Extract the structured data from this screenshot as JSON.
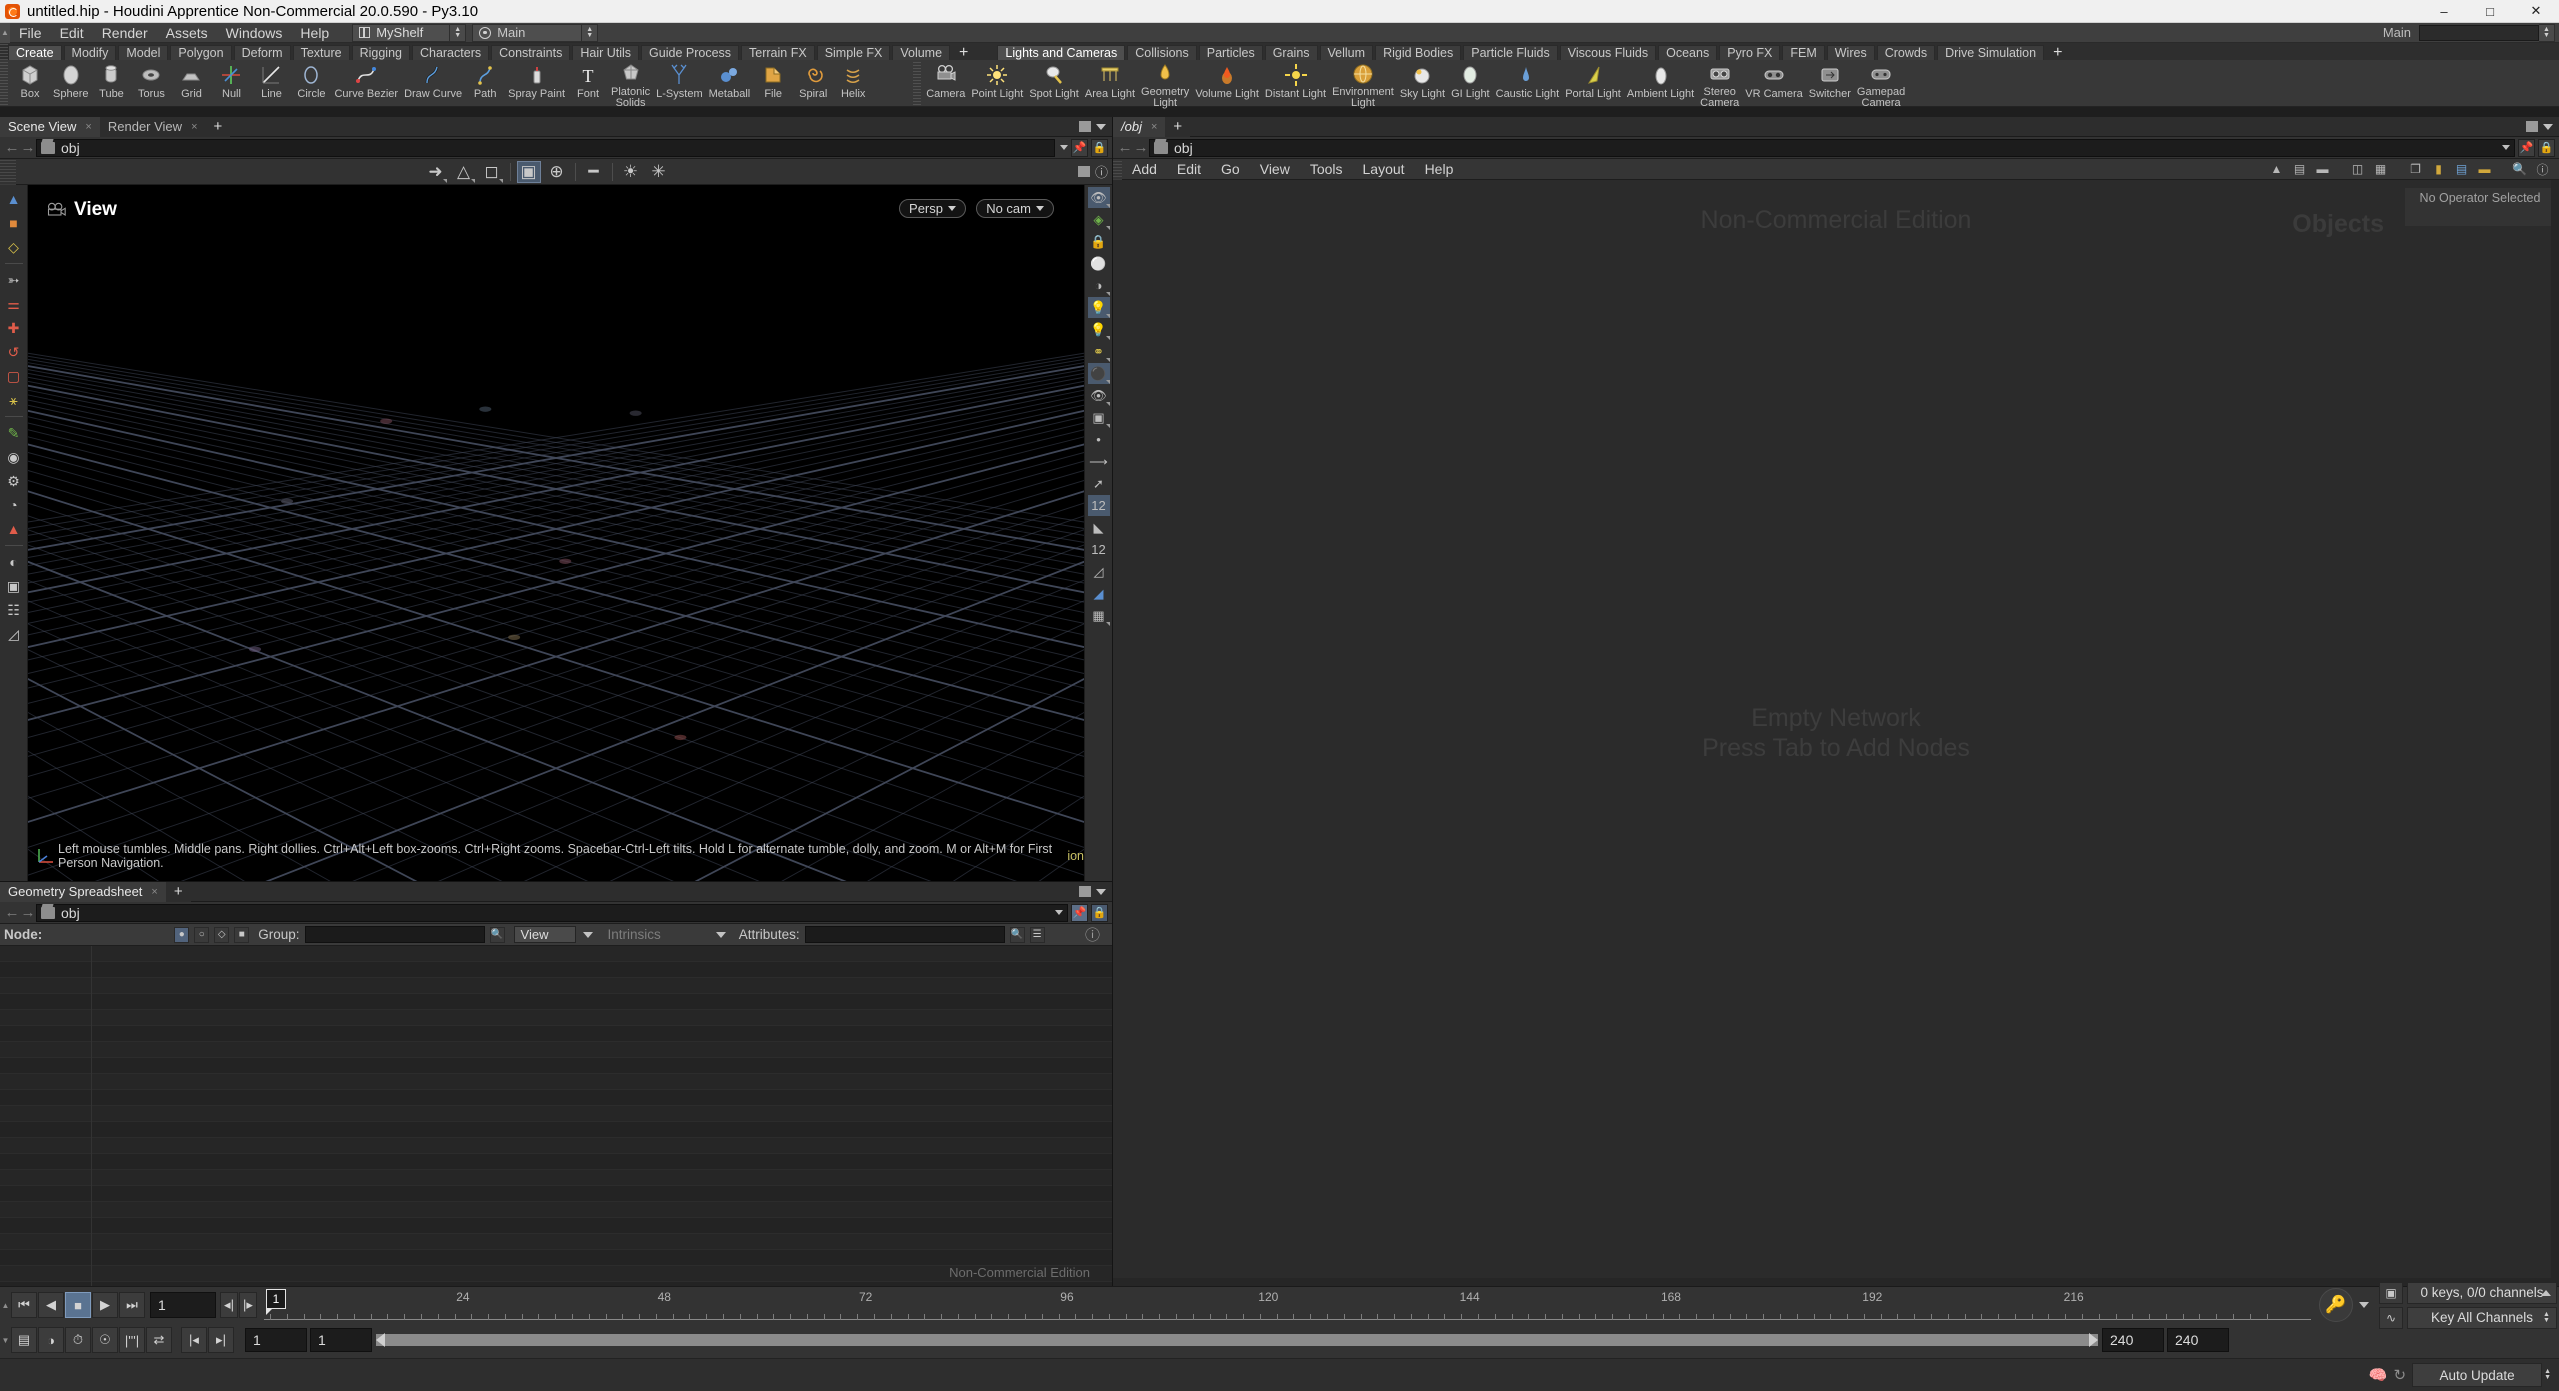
{
  "window": {
    "title": "untitled.hip - Houdini Apprentice Non-Commercial 20.0.590 - Py3.10",
    "minimize": "–",
    "maximize": "□",
    "close": "✕"
  },
  "menubar": {
    "items": [
      "File",
      "Edit",
      "Render",
      "Assets",
      "Windows",
      "Help"
    ],
    "shelf_set": "MyShelf",
    "desktop": "Main",
    "right_label": "Main"
  },
  "shelf": {
    "tabs_left": [
      "Create",
      "Modify",
      "Model",
      "Polygon",
      "Deform",
      "Texture",
      "Rigging",
      "Characters",
      "Constraints",
      "Hair Utils",
      "Guide Process",
      "Terrain FX",
      "Simple FX",
      "Volume"
    ],
    "selected_left": "Create",
    "add_tab": "+",
    "tabs_right": [
      "Lights and Cameras",
      "Collisions",
      "Particles",
      "Grains",
      "Vellum",
      "Rigid Bodies",
      "Particle Fluids",
      "Viscous Fluids",
      "Oceans",
      "Pyro FX",
      "FEM",
      "Wires",
      "Crowds",
      "Drive Simulation"
    ],
    "selected_right": "Lights and Cameras",
    "tools_left": [
      {
        "label": "Box",
        "icon": "box-icon"
      },
      {
        "label": "Sphere",
        "icon": "sphere-icon"
      },
      {
        "label": "Tube",
        "icon": "tube-icon"
      },
      {
        "label": "Torus",
        "icon": "torus-icon"
      },
      {
        "label": "Grid",
        "icon": "grid-icon"
      },
      {
        "label": "Null",
        "icon": "null-icon"
      },
      {
        "label": "Line",
        "icon": "line-icon"
      },
      {
        "label": "Circle",
        "icon": "circle-icon"
      },
      {
        "label": "Curve Bezier",
        "icon": "curve-bezier-icon"
      },
      {
        "label": "Draw Curve",
        "icon": "draw-curve-icon"
      },
      {
        "label": "Path",
        "icon": "path-icon"
      },
      {
        "label": "Spray Paint",
        "icon": "spray-paint-icon"
      },
      {
        "label": "Font",
        "icon": "font-icon"
      },
      {
        "label": "Platonic\nSolids",
        "icon": "platonic-solids-icon"
      },
      {
        "label": "L-System",
        "icon": "l-system-icon"
      },
      {
        "label": "Metaball",
        "icon": "metaball-icon"
      },
      {
        "label": "File",
        "icon": "file-icon"
      },
      {
        "label": "Spiral",
        "icon": "spiral-icon"
      },
      {
        "label": "Helix",
        "icon": "helix-icon"
      }
    ],
    "tools_right": [
      {
        "label": "Camera",
        "icon": "camera-icon"
      },
      {
        "label": "Point Light",
        "icon": "point-light-icon"
      },
      {
        "label": "Spot Light",
        "icon": "spot-light-icon"
      },
      {
        "label": "Area Light",
        "icon": "area-light-icon"
      },
      {
        "label": "Geometry\nLight",
        "icon": "geometry-light-icon"
      },
      {
        "label": "Volume Light",
        "icon": "volume-light-icon"
      },
      {
        "label": "Distant Light",
        "icon": "distant-light-icon"
      },
      {
        "label": "Environment\nLight",
        "icon": "environment-light-icon"
      },
      {
        "label": "Sky Light",
        "icon": "sky-light-icon"
      },
      {
        "label": "GI Light",
        "icon": "gi-light-icon"
      },
      {
        "label": "Caustic Light",
        "icon": "caustic-light-icon"
      },
      {
        "label": "Portal Light",
        "icon": "portal-light-icon"
      },
      {
        "label": "Ambient Light",
        "icon": "ambient-light-icon"
      },
      {
        "label": "Stereo\nCamera",
        "icon": "stereo-camera-icon"
      },
      {
        "label": "VR Camera",
        "icon": "vr-camera-icon"
      },
      {
        "label": "Switcher",
        "icon": "switcher-icon"
      },
      {
        "label": "Gamepad\nCamera",
        "icon": "gamepad-camera-icon"
      }
    ]
  },
  "scene_view": {
    "tabs": [
      "Scene View",
      "Render View"
    ],
    "selected_tab": "Scene View",
    "add_tab": "+",
    "path": "obj",
    "view_label": "View",
    "camera_mode": "Persp",
    "camera_select": "No cam",
    "status_text": "Left mouse tumbles. Middle pans. Right dollies. Ctrl+Alt+Left box-zooms. Ctrl+Right zooms. Spacebar-Ctrl-Left tilts. Hold L for alternate tumble, dolly, and zoom. M or Alt+M for First Person Navigation.",
    "status_trail": "ion"
  },
  "geometry_spreadsheet": {
    "tabs": [
      "Geometry Spreadsheet"
    ],
    "selected_tab": "Geometry Spreadsheet",
    "add_tab": "+",
    "path": "obj",
    "node_label": "Node:",
    "group_label": "Group:",
    "view_label": "View",
    "intrinsics_label": "Intrinsics",
    "attributes_label": "Attributes:",
    "group_value": "",
    "attributes_value": "",
    "watermark": "Non-Commercial Edition"
  },
  "network_editor": {
    "tabs": [
      "/obj"
    ],
    "selected_tab": "/obj",
    "add_tab": "+",
    "path": "obj",
    "menu": [
      "Add",
      "Edit",
      "Go",
      "View",
      "Tools",
      "Layout",
      "Help"
    ],
    "watermark": "Non-Commercial Edition",
    "context_label": "Objects",
    "operator_status": "No Operator Selected",
    "empty_line1": "Empty Network",
    "empty_line2": "Press Tab to Add Nodes"
  },
  "playbar": {
    "current_frame": "1",
    "frame_field": "1",
    "range_start": "1",
    "range_start2": "1",
    "range_end": "240",
    "global_end": "240",
    "keys_status": "0 keys, 0/0 channels",
    "key_all_channels": "Key All Channels",
    "auto_update": "Auto Update",
    "tick_labels": [
      "24",
      "48",
      "72",
      "96",
      "120",
      "144",
      "168",
      "192",
      "216"
    ],
    "tick_values": [
      24,
      48,
      72,
      96,
      120,
      144,
      168,
      192,
      216
    ],
    "frame_min": 1,
    "frame_max": 240,
    "transport": [
      {
        "name": "jump-to-start-button",
        "glyph": "⏮"
      },
      {
        "name": "step-back-button",
        "glyph": "◀"
      },
      {
        "name": "play-stop-button",
        "glyph": "■"
      },
      {
        "name": "play-forward-button",
        "glyph": "▶"
      },
      {
        "name": "jump-to-end-button",
        "glyph": "⏭"
      }
    ]
  },
  "colors": {
    "accent_blue": "#5a7391",
    "panel_bg": "#333333",
    "viewport_bg": "#000000",
    "grid_line": "#4a5060",
    "text": "#c8c8c8"
  }
}
